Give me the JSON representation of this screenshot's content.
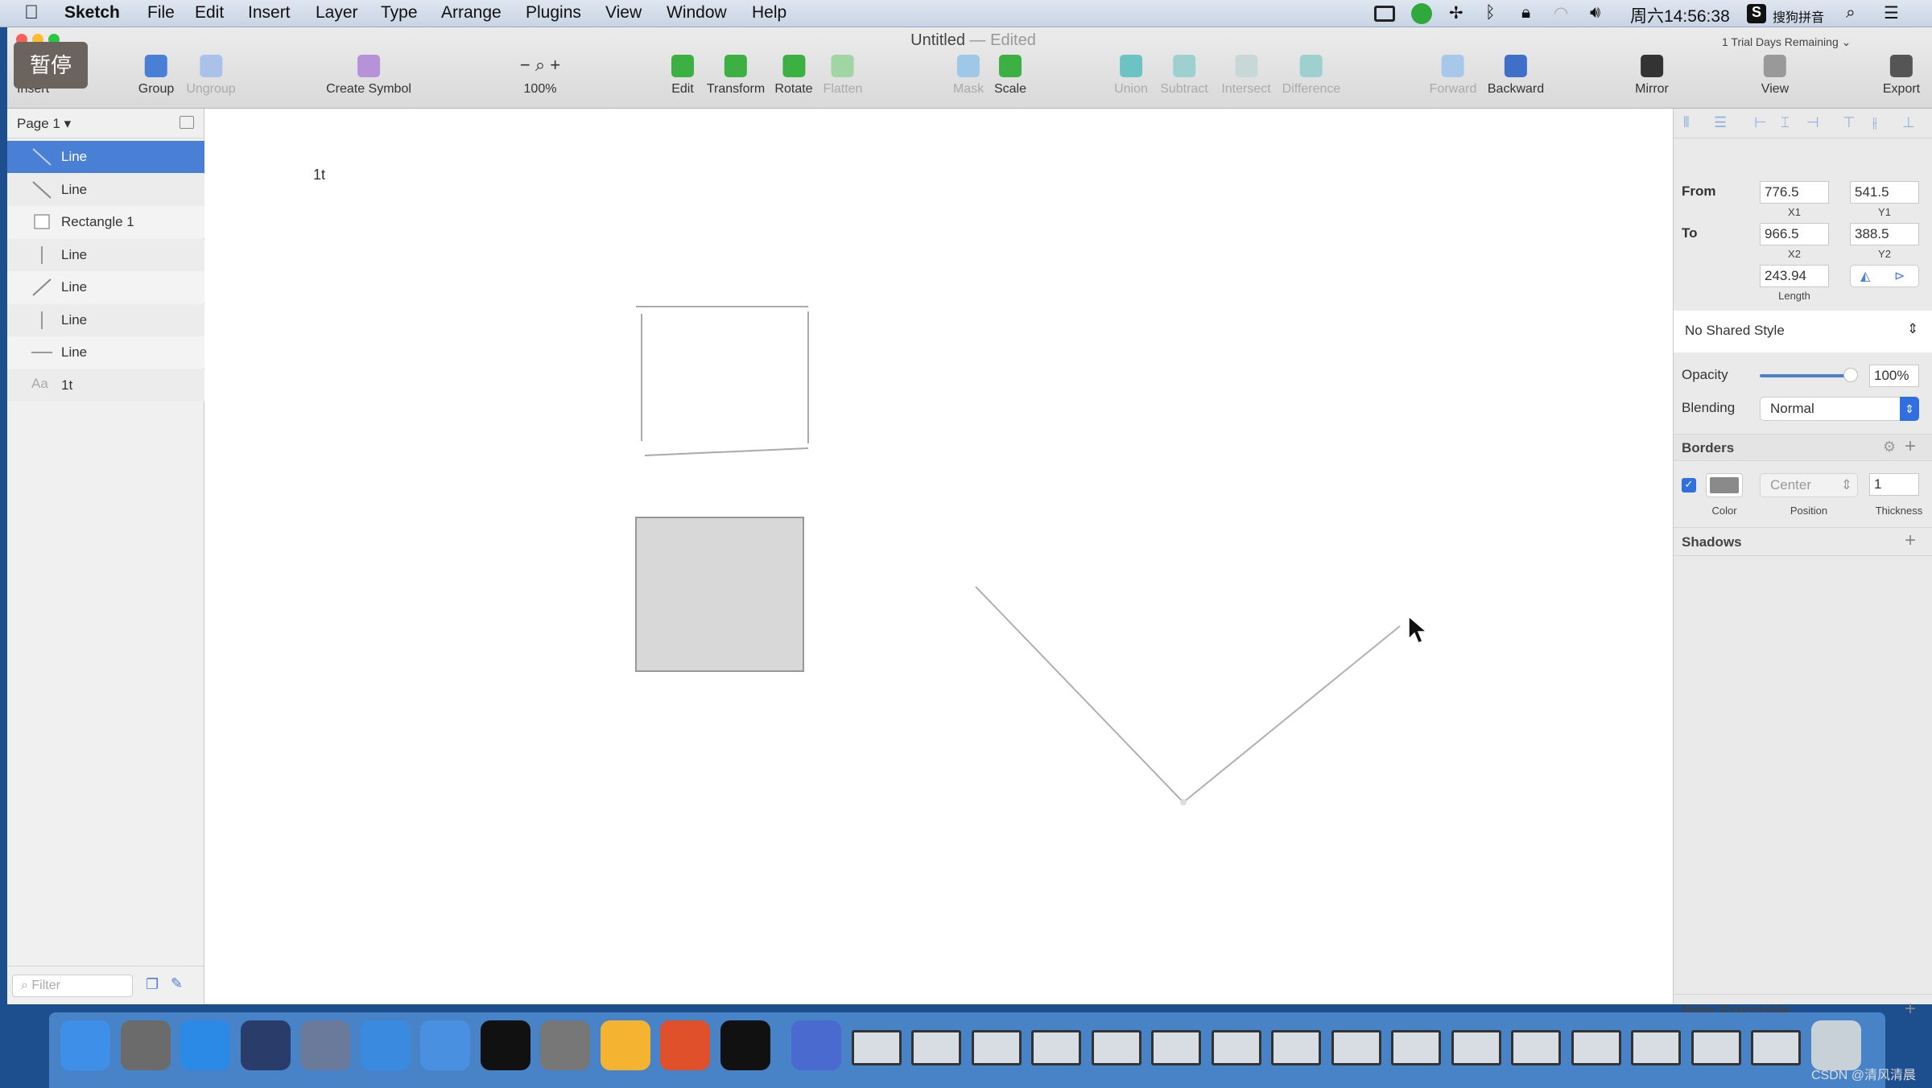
{
  "menubar": {
    "app": "Sketch",
    "items": [
      "File",
      "Edit",
      "Insert",
      "Layer",
      "Type",
      "Arrange",
      "Plugins",
      "View",
      "Window",
      "Help"
    ],
    "clock": "周六14:56:38",
    "ime": "搜狗拼音"
  },
  "overlay": {
    "pause": "暂停"
  },
  "window": {
    "title": "Untitled",
    "edited": "— Edited",
    "trial": "1 Trial Days Remaining"
  },
  "toolbar": [
    {
      "label": "Insert",
      "icon": "insert-icon",
      "enabled": true
    },
    {
      "label": "Group",
      "icon": "group-icon",
      "enabled": true
    },
    {
      "label": "Ungroup",
      "icon": "ungroup-icon",
      "enabled": false
    },
    {
      "label": "Create Symbol",
      "icon": "symbol-icon",
      "enabled": true
    },
    {
      "label": "100%",
      "icon": "zoom-icon",
      "enabled": true
    },
    {
      "label": "Edit",
      "icon": "edit-icon",
      "enabled": true
    },
    {
      "label": "Transform",
      "icon": "transform-icon",
      "enabled": true
    },
    {
      "label": "Rotate",
      "icon": "rotate-icon",
      "enabled": true
    },
    {
      "label": "Flatten",
      "icon": "flatten-icon",
      "enabled": false
    },
    {
      "label": "Mask",
      "icon": "mask-icon",
      "enabled": false
    },
    {
      "label": "Scale",
      "icon": "scale-icon",
      "enabled": true
    },
    {
      "label": "Union",
      "icon": "union-icon",
      "enabled": false
    },
    {
      "label": "Subtract",
      "icon": "subtract-icon",
      "enabled": false
    },
    {
      "label": "Intersect",
      "icon": "intersect-icon",
      "enabled": false
    },
    {
      "label": "Difference",
      "icon": "difference-icon",
      "enabled": false
    },
    {
      "label": "Forward",
      "icon": "forward-icon",
      "enabled": false
    },
    {
      "label": "Backward",
      "icon": "backward-icon",
      "enabled": true
    },
    {
      "label": "Mirror",
      "icon": "mirror-icon",
      "enabled": true
    },
    {
      "label": "View",
      "icon": "view-icon",
      "enabled": true
    },
    {
      "label": "Export",
      "icon": "export-icon",
      "enabled": true
    }
  ],
  "layers": {
    "page": "Page 1",
    "filter_placeholder": "Filter",
    "items": [
      {
        "name": "Line",
        "icon": "line-diagonal-down-icon",
        "selected": true
      },
      {
        "name": "Line",
        "icon": "line-diagonal-down-icon"
      },
      {
        "name": "Rectangle 1",
        "icon": "rectangle-icon"
      },
      {
        "name": "Line",
        "icon": "line-vertical-icon"
      },
      {
        "name": "Line",
        "icon": "line-diagonal-up-icon"
      },
      {
        "name": "Line",
        "icon": "line-vertical-icon"
      },
      {
        "name": "Line",
        "icon": "line-horizontal-icon"
      },
      {
        "name": "1t",
        "icon": "text-icon"
      }
    ]
  },
  "canvas": {
    "text": "1t"
  },
  "inspector": {
    "from_label": "From",
    "to_label": "To",
    "x1": "776.5",
    "y1": "541.5",
    "x2": "966.5",
    "y2": "388.5",
    "x1_label": "X1",
    "y1_label": "Y1",
    "x2_label": "X2",
    "y2_label": "Y2",
    "length": "243.94",
    "length_label": "Length",
    "shared_style": "No Shared Style",
    "opacity_label": "Opacity",
    "opacity": "100%",
    "opacity_value": 1.0,
    "blending_label": "Blending",
    "blending": "Normal",
    "borders": "Borders",
    "border_enabled": true,
    "border_color": "#8a8a8a",
    "position": "Center",
    "thickness": "1",
    "color_label": "Color",
    "position_label": "Position",
    "thickness_label": "Thickness",
    "shadows": "Shadows",
    "make_exportable": "Make Exportable"
  },
  "colors": {
    "accent": "#4a7fd6"
  },
  "dock": [
    "finder",
    "launchpad",
    "safari",
    "mouse-app",
    "imovie",
    "xcode",
    "simulator",
    "terminal",
    "system-preferences",
    "sketch",
    "presentation",
    "console",
    "media-player",
    "window-1",
    "window-2",
    "window-3",
    "window-4",
    "window-5",
    "window-6",
    "window-7",
    "window-8",
    "window-9",
    "window-10",
    "window-11",
    "window-12",
    "window-13",
    "window-14",
    "window-15",
    "window-16",
    "trash"
  ],
  "watermark": "CSDN @清风清晨"
}
